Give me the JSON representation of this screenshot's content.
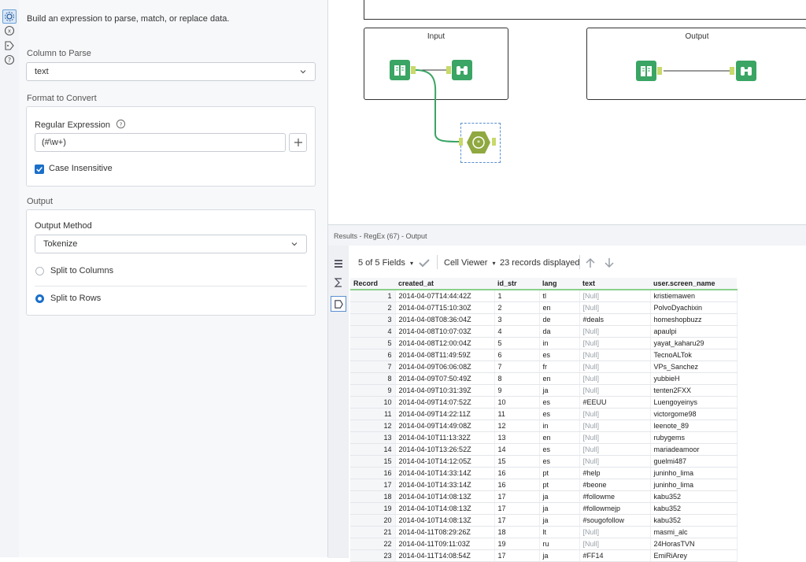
{
  "config": {
    "description": "Build an expression to parse, match, or replace data.",
    "column_to_parse_label": "Column to Parse",
    "column_to_parse_value": "text",
    "format_label": "Format to Convert",
    "regex_label": "Regular Expression",
    "regex_value": "(#\\w+)",
    "case_insensitive_label": "Case Insensitive",
    "output_label": "Output",
    "output_method_label": "Output Method",
    "output_method_value": "Tokenize",
    "split_columns_label": "Split to Columns",
    "split_rows_label": "Split to Rows"
  },
  "canvas": {
    "input_title": "Input",
    "output_title": "Output"
  },
  "results": {
    "title": "Results - RegEx (67) - Output",
    "fields_label": "5 of 5 Fields",
    "cell_viewer_label": "Cell Viewer",
    "records_label": "23 records displayed",
    "columns": [
      "Record",
      "created_at",
      "id_str",
      "lang",
      "text",
      "user.screen_name"
    ],
    "rows": [
      [
        "1",
        "2014-04-07T14:44:42Z",
        "1",
        "tl",
        "[Null]",
        "kristiemawen"
      ],
      [
        "2",
        "2014-04-07T15:10:30Z",
        "2",
        "en",
        "[Null]",
        "PolvoDyachixin"
      ],
      [
        "3",
        "2014-04-08T08:36:04Z",
        "3",
        "de",
        "#deals",
        "homeshopbuzz"
      ],
      [
        "4",
        "2014-04-08T10:07:03Z",
        "4",
        "da",
        "[Null]",
        "apaulpi"
      ],
      [
        "5",
        "2014-04-08T12:00:04Z",
        "5",
        "in",
        "[Null]",
        "yayat_kaharu29"
      ],
      [
        "6",
        "2014-04-08T11:49:59Z",
        "6",
        "es",
        "[Null]",
        "TecnoALTok"
      ],
      [
        "7",
        "2014-04-09T06:06:08Z",
        "7",
        "fr",
        "[Null]",
        "VPs_Sanchez"
      ],
      [
        "8",
        "2014-04-09T07:50:49Z",
        "8",
        "en",
        "[Null]",
        "yubbieH"
      ],
      [
        "9",
        "2014-04-09T10:31:39Z",
        "9",
        "ja",
        "[Null]",
        "tenten2FXX"
      ],
      [
        "10",
        "2014-04-09T14:07:52Z",
        "10",
        "es",
        "#EEUU",
        "Luengoyeinys"
      ],
      [
        "11",
        "2014-04-09T14:22:11Z",
        "11",
        "es",
        "[Null]",
        "victorgome98"
      ],
      [
        "12",
        "2014-04-09T14:49:08Z",
        "12",
        "in",
        "[Null]",
        "leenote_89"
      ],
      [
        "13",
        "2014-04-10T11:13:32Z",
        "13",
        "en",
        "[Null]",
        "rubygems"
      ],
      [
        "14",
        "2014-04-10T13:26:52Z",
        "14",
        "es",
        "[Null]",
        "mariadeamoor"
      ],
      [
        "15",
        "2014-04-10T14:12:05Z",
        "15",
        "es",
        "[Null]",
        "guelmi487"
      ],
      [
        "16",
        "2014-04-10T14:33:14Z",
        "16",
        "pt",
        "#help",
        "juninho_lima"
      ],
      [
        "17",
        "2014-04-10T14:33:14Z",
        "16",
        "pt",
        "#beone",
        "juninho_lima"
      ],
      [
        "18",
        "2014-04-10T14:08:13Z",
        "17",
        "ja",
        "#followme",
        "kabu352"
      ],
      [
        "19",
        "2014-04-10T14:08:13Z",
        "17",
        "ja",
        "#followmejp",
        "kabu352"
      ],
      [
        "20",
        "2014-04-10T14:08:13Z",
        "17",
        "ja",
        "#sougofollow",
        "kabu352"
      ],
      [
        "21",
        "2014-04-11T08:29:26Z",
        "18",
        "lt",
        "[Null]",
        "masmi_alc"
      ],
      [
        "22",
        "2014-04-11T09:11:03Z",
        "19",
        "ru",
        "[Null]",
        "24HorasTVN"
      ],
      [
        "23",
        "2014-04-11T14:08:54Z",
        "17",
        "ja",
        "#FF14",
        "EmiRiArey"
      ]
    ]
  },
  "colors": {
    "accent": "#1a6fc9",
    "tool_green": "#3aa564",
    "tool_olive": "#8fa840",
    "connector": "#3aa564"
  }
}
